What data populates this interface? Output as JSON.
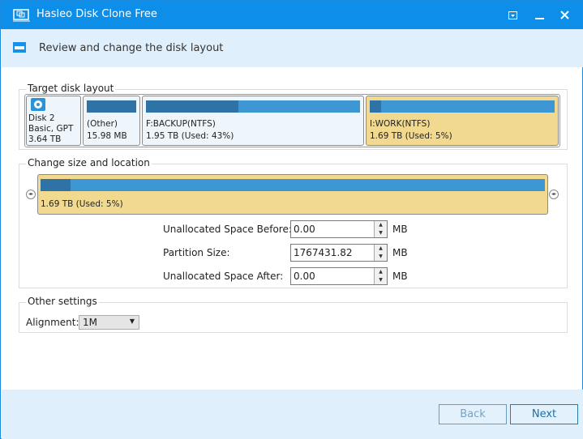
{
  "window": {
    "title": "Hasleo Disk Clone Free"
  },
  "header": {
    "subtitle": "Review and change the disk layout"
  },
  "target": {
    "label": "Target disk layout",
    "disk": {
      "name": "Disk 2",
      "type": "Basic, GPT",
      "size": "3.64 TB"
    },
    "partitions": [
      {
        "name": "(Other)",
        "info": "15.98 MB",
        "used_pct": 100
      },
      {
        "name": "F:BACKUP(NTFS)",
        "info": "1.95 TB (Used: 43%)",
        "used_pct": 43
      },
      {
        "name": "I:WORK(NTFS)",
        "info": "1.69 TB (Used: 5%)",
        "used_pct": 5,
        "selected": true
      }
    ]
  },
  "change": {
    "label": "Change size and location",
    "bar_info": "1.69 TB (Used: 5%)",
    "used_pct": 5,
    "fields": [
      {
        "label": "Unallocated Space Before:",
        "value": "0.00",
        "unit": "MB"
      },
      {
        "label": "Partition Size:",
        "value": "1767431.82",
        "unit": "MB"
      },
      {
        "label": "Unallocated Space After:",
        "value": "0.00",
        "unit": "MB"
      }
    ]
  },
  "other": {
    "label": "Other settings",
    "alignment_label": "Alignment:",
    "alignment_value": "1M"
  },
  "footer": {
    "back": "Back",
    "next": "Next"
  },
  "colors": {
    "titlebar": "#0d8fe9",
    "header": "#dfeffc",
    "selected_partition": "#f1da8f",
    "bar": "#3e96d2",
    "used": "#2f72a6"
  }
}
